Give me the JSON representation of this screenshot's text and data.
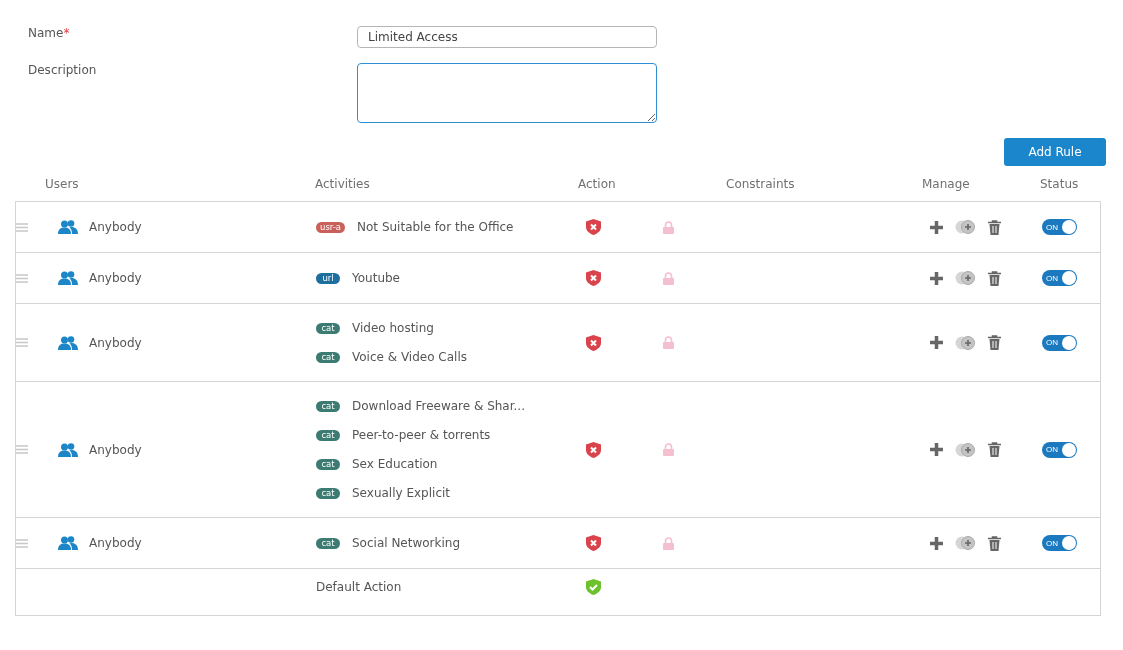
{
  "form": {
    "name_label": "Name",
    "required_mark": "*",
    "name_value": "Limited Access",
    "description_label": "Description"
  },
  "add_rule": "Add Rule",
  "columns": [
    "Users",
    "Activities",
    "Action",
    "Constraints",
    "Manage",
    "Status"
  ],
  "rows": [
    {
      "kind": "rule",
      "user": "Anybody",
      "activities": [
        {
          "tag": "usr-a",
          "color": "#c9605a",
          "label": "Not Suitable for the Office"
        }
      ],
      "blocked": true,
      "status": {
        "label": "ON",
        "on": true
      }
    },
    {
      "kind": "rule",
      "user": "Anybody",
      "activities": [
        {
          "tag": "url",
          "color": "#1f6f9e",
          "label": "Youtube"
        }
      ],
      "blocked": true,
      "status": {
        "label": "ON",
        "on": true
      }
    },
    {
      "kind": "rule",
      "user": "Anybody",
      "activities": [
        {
          "tag": "cat",
          "color": "#3b7b72",
          "label": "Video hosting"
        },
        {
          "tag": "cat",
          "color": "#3b7b72",
          "label": "Voice & Video Calls"
        }
      ],
      "blocked": true,
      "status": {
        "label": "ON",
        "on": true
      }
    },
    {
      "kind": "rule",
      "user": "Anybody",
      "activities": [
        {
          "tag": "cat",
          "color": "#3b7b72",
          "label": "Download Freeware & Shar..."
        },
        {
          "tag": "cat",
          "color": "#3b7b72",
          "label": "Peer-to-peer & torrents"
        },
        {
          "tag": "cat",
          "color": "#3b7b72",
          "label": "Sex Education"
        },
        {
          "tag": "cat",
          "color": "#3b7b72",
          "label": "Sexually Explicit"
        }
      ],
      "blocked": true,
      "status": {
        "label": "ON",
        "on": true
      }
    },
    {
      "kind": "rule",
      "user": "Anybody",
      "activities": [
        {
          "tag": "cat",
          "color": "#3b7b72",
          "label": "Social Networking"
        }
      ],
      "blocked": true,
      "status": {
        "label": "ON",
        "on": true
      }
    },
    {
      "kind": "default",
      "label": "Default Action",
      "blocked": false
    }
  ]
}
